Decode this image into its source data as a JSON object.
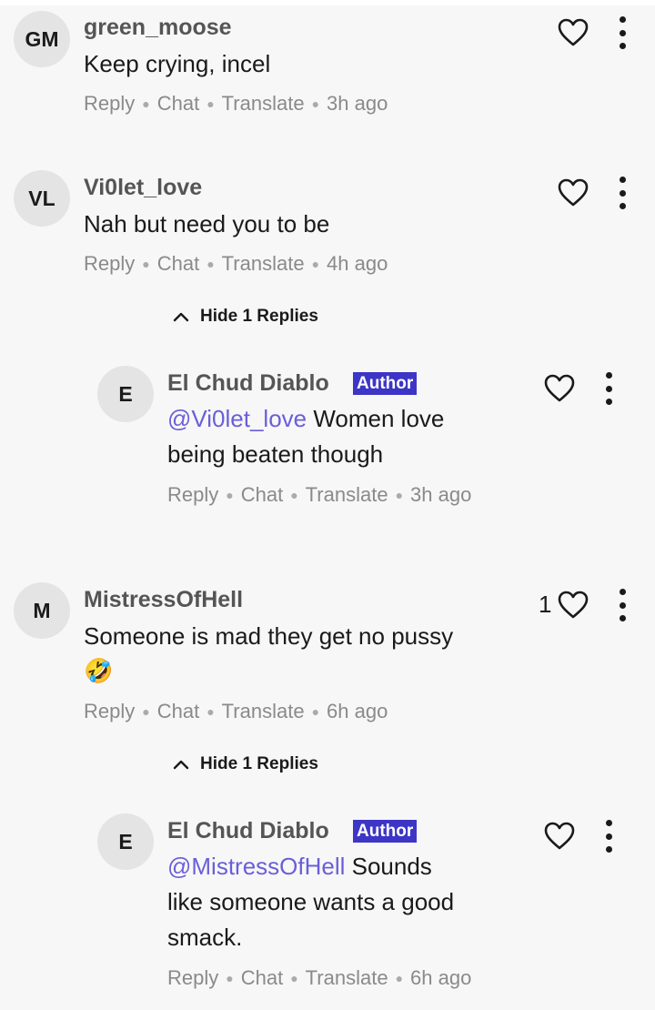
{
  "comments": [
    {
      "initials": "GM",
      "username": "green_moose",
      "lines": [
        "Keep crying, incel"
      ],
      "actions": [
        "Reply",
        "Chat",
        "Translate"
      ],
      "time": "3h ago"
    },
    {
      "initials": "VL",
      "username": "Vi0let_love",
      "lines": [
        "Nah but need you to be"
      ],
      "actions": [
        "Reply",
        "Chat",
        "Translate"
      ],
      "time": "4h ago",
      "toggle_label": "Hide 1 Replies",
      "reply": {
        "initials": "E",
        "username": "El Chud Diablo",
        "badge": "Author",
        "mention": "@Vi0let_love",
        "line1_rest": " Women love",
        "line2": "being beaten though",
        "actions": [
          "Reply",
          "Chat",
          "Translate"
        ],
        "time": "3h ago"
      }
    },
    {
      "initials": "M",
      "username": "MistressOfHell",
      "like_count": "1",
      "lines": [
        "Someone is mad they get no pussy"
      ],
      "emoji": "🤣",
      "actions": [
        "Reply",
        "Chat",
        "Translate"
      ],
      "time": "6h ago",
      "toggle_label": "Hide 1 Replies",
      "reply": {
        "initials": "E",
        "username": "El Chud Diablo",
        "badge": "Author",
        "mention": "@MistressOfHell",
        "line1_rest": " Sounds",
        "line2": "like someone wants a good",
        "line3": "smack.",
        "actions": [
          "Reply",
          "Chat",
          "Translate"
        ],
        "time": "6h ago"
      }
    }
  ],
  "icons": {
    "like": "heart-icon",
    "more": "more-vertical-icon",
    "toggle": "chevron-up-icon"
  },
  "colors": {
    "mention": "#6a5fd8",
    "author_badge": "#3d35c6",
    "background": "#f7f7f7"
  }
}
